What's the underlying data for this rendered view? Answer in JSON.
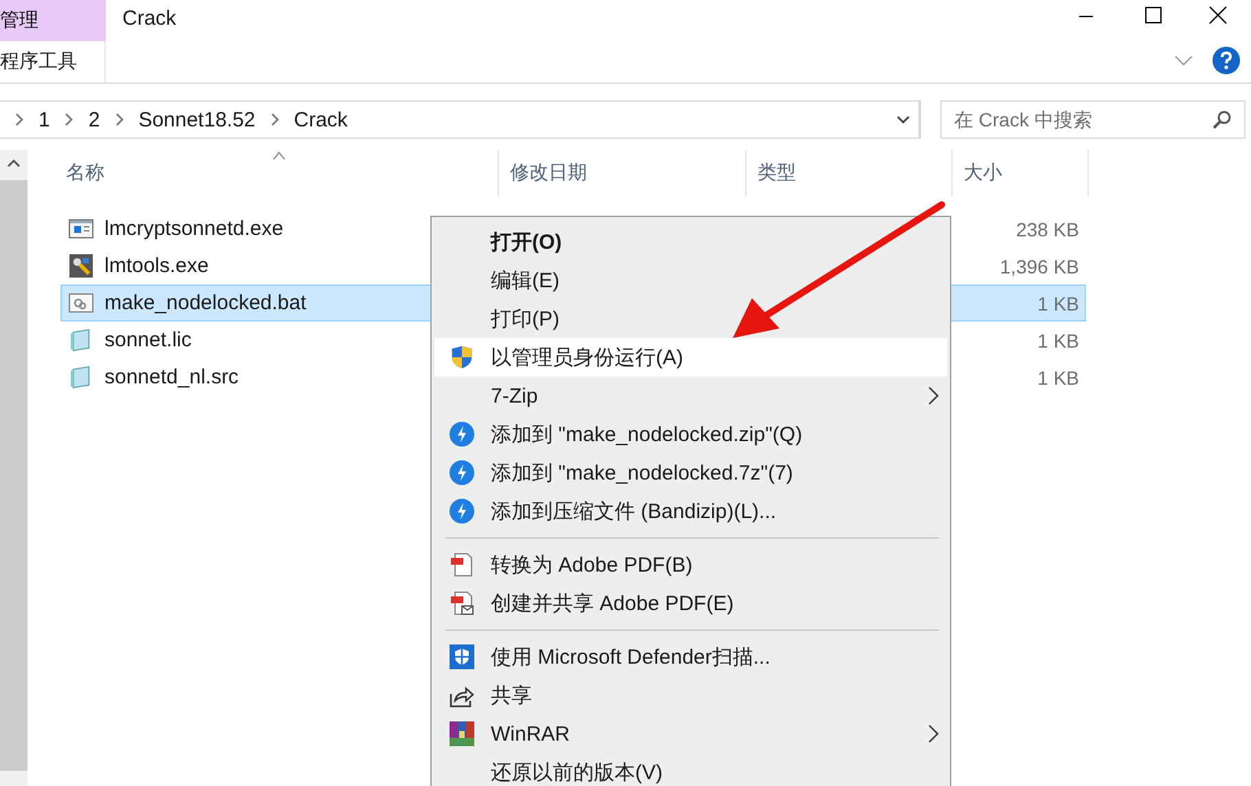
{
  "window": {
    "title": "Crack"
  },
  "ribbon": {
    "tabs": [
      {
        "label": "管理",
        "selected": true
      }
    ],
    "group_label": "程序工具"
  },
  "address": {
    "path": [
      "1",
      "2",
      "Sonnet18.52",
      "Crack"
    ],
    "search": {
      "placeholder": "在 Crack 中搜索"
    }
  },
  "table": {
    "columns": [
      "名称",
      "修改日期",
      "类型",
      "大小"
    ],
    "rows": [
      {
        "name": "lmcryptsonnetd.exe",
        "kind": "app",
        "size": "238 KB",
        "selected": false
      },
      {
        "name": "lmtools.exe",
        "kind": "tools",
        "size": "1,396 KB",
        "selected": false
      },
      {
        "name": "make_nodelocked.bat",
        "kind": "batch",
        "size": "1 KB",
        "selected": true
      },
      {
        "name": "sonnet.lic",
        "kind": "text",
        "size": "1 KB",
        "selected": false
      },
      {
        "name": "sonnetd_nl.src",
        "kind": "text",
        "size": "1 KB",
        "selected": false
      }
    ]
  },
  "context_menu": {
    "items": [
      {
        "kind": "plain",
        "label": "打开(O)",
        "bold": true,
        "selected": false
      },
      {
        "kind": "plain",
        "label": "编辑(E)",
        "bold": false,
        "selected": false
      },
      {
        "kind": "plain",
        "label": "打印(P)",
        "bold": false,
        "selected": false
      },
      {
        "kind": "shield",
        "label": "以管理员身份运行(A)",
        "bold": false,
        "selected": true
      },
      {
        "kind": "plain",
        "label": "7-Zip",
        "submenu": true,
        "bold": false,
        "selected": false
      },
      {
        "kind": "bandizip",
        "label": "添加到 \"make_nodelocked.zip\"(Q)",
        "bold": false,
        "selected": false
      },
      {
        "kind": "bandizip",
        "label": "添加到 \"make_nodelocked.7z\"(7)",
        "bold": false,
        "selected": false
      },
      {
        "kind": "bandizip",
        "label": "添加到压缩文件 (Bandizip)(L)...",
        "bold": false,
        "selected": false
      },
      {
        "kind": "separator"
      },
      {
        "kind": "pdf",
        "label": "转换为 Adobe PDF(B)",
        "bold": false,
        "selected": false
      },
      {
        "kind": "pdfmail",
        "label": "创建并共享 Adobe PDF(E)",
        "bold": false,
        "selected": false
      },
      {
        "kind": "separator"
      },
      {
        "kind": "defender",
        "label": "使用 Microsoft Defender扫描...",
        "bold": false,
        "selected": false
      },
      {
        "kind": "share",
        "label": "共享",
        "bold": false,
        "selected": false
      },
      {
        "kind": "winrar",
        "label": "WinRAR",
        "submenu": true,
        "bold": false,
        "selected": false
      },
      {
        "kind": "plain",
        "label": "还原以前的版本(V)",
        "bold": false,
        "selected": false
      }
    ]
  }
}
